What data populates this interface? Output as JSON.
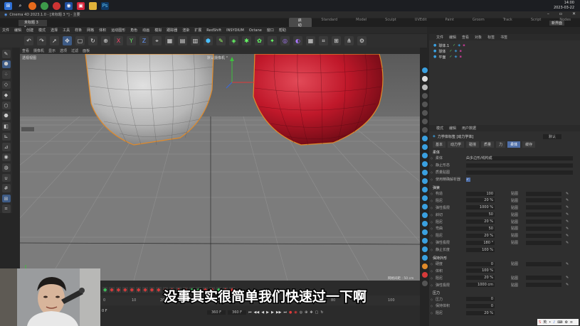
{
  "taskbar": {
    "time": "14:00",
    "date": "2023-03-22",
    "apps": [
      "windows-icon",
      "search-icon",
      "firefox-icon",
      "chrome-icon",
      "app-icon",
      "cinema4d-icon",
      "app-red-icon",
      "folder-icon",
      "photoshop-icon"
    ]
  },
  "window": {
    "title": "Cinema 4D 2023.1.0 - [未标题 3 *] - 主要",
    "doc_tab": "未标题 3 *",
    "layout_tabs": [
      "启动",
      "Standard",
      "Model",
      "Sculpt",
      "UVEdit",
      "Paint",
      "Groom",
      "Track",
      "Script",
      "Nodes"
    ],
    "active_layout": "启动",
    "new_layout": "新界面"
  },
  "menu": [
    "文件",
    "编辑",
    "创建",
    "模式",
    "选择",
    "工具",
    "样条",
    "网格",
    "体积",
    "运动图形",
    "角色",
    "动画",
    "模拟",
    "跟踪器",
    "渲染",
    "扩展",
    "RedShift",
    "INSYDIUM",
    "Octane",
    "窗口",
    "帮助"
  ],
  "viewport": {
    "menu": [
      "查看",
      "摄像机",
      "显示",
      "选项",
      "过滤",
      "面板"
    ],
    "label": "透视视图",
    "camera": "默认摄像机 °",
    "grid_info": "网格间距 : 50 cm"
  },
  "timeline": {
    "ticks": [
      "0",
      "10",
      "20",
      "30",
      "40",
      "50",
      "60",
      "70",
      "80",
      "90",
      "100"
    ],
    "frame_start": "0 F",
    "frame_end": "360 F",
    "frame_end2": "360 F"
  },
  "object_manager": {
    "menu": [
      "文件",
      "编辑",
      "查看",
      "对象",
      "标签",
      "书签"
    ],
    "objects": [
      {
        "name": "球体.1",
        "color": "#3aa0e0"
      },
      {
        "name": "球体",
        "color": "#3aa0e0"
      },
      {
        "name": "平面",
        "color": "#3aa0e0"
      }
    ]
  },
  "attributes": {
    "menu": [
      "模式",
      "编辑",
      "用户数据"
    ],
    "object_title": "力学体标签 [动力学体]",
    "preset": "默认",
    "tabs": [
      "基本",
      "动力学",
      "碰撞",
      "质量",
      "力",
      "柔体",
      "缓存"
    ],
    "active_tab": "柔体",
    "section_softbody": "柔体",
    "props_top": [
      {
        "label": "柔体",
        "value": "由多边形/线构成"
      },
      {
        "label": "静止形态",
        "value": ""
      },
      {
        "label": "质量贴图",
        "value": ""
      },
      {
        "label": "使用精确解析器",
        "value": "✓"
      }
    ],
    "section_spring": "弹簧",
    "props_spring": [
      {
        "label": "构造",
        "value": "100",
        "map": "贴图"
      },
      {
        "label": "阻尼",
        "value": "20 %",
        "map": "贴图"
      },
      {
        "label": "弹性极限",
        "value": "1000 %",
        "map": "贴图"
      },
      {
        "label": "斜切",
        "value": "50",
        "map": "贴图"
      },
      {
        "label": "阻尼",
        "value": "20 %",
        "map": "贴图"
      },
      {
        "label": "弯曲",
        "value": "50",
        "map": "贴图"
      },
      {
        "label": "阻尼",
        "value": "20 %",
        "map": "贴图"
      },
      {
        "label": "弹性极限",
        "value": "180 °",
        "map": "贴图"
      },
      {
        "label": "静止长度",
        "value": "100 %",
        "map": ""
      }
    ],
    "section_shape": "保持外形",
    "props_shape": [
      {
        "label": "硬度",
        "value": "0",
        "map": "贴图"
      },
      {
        "label": "体积",
        "value": "100 %",
        "map": ""
      },
      {
        "label": "阻尼",
        "value": "20 %",
        "map": "贴图"
      },
      {
        "label": "弹性极限",
        "value": "1000 cm",
        "map": "贴图"
      }
    ],
    "section_pressure": "压力",
    "props_pressure": [
      {
        "label": "压力",
        "value": "0",
        "map": ""
      },
      {
        "label": "保持体积",
        "value": "0",
        "map": ""
      },
      {
        "label": "阻尼",
        "value": "20 %",
        "map": ""
      }
    ]
  },
  "subtitle": "没事其实很简单我们快速过一下啊",
  "colors": {
    "red_sphere": "#c0182a",
    "grey_sphere": "#bdbdbd",
    "selection_outline": "#e08a2a",
    "accent": "#4f6fa8"
  }
}
